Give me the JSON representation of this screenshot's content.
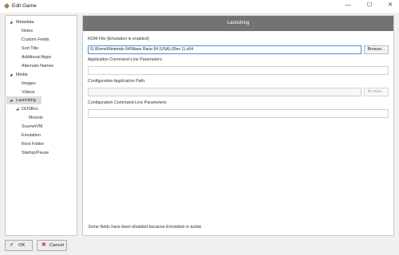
{
  "window": {
    "title": "Edit Game",
    "minimize_glyph": "—",
    "maximize_glyph": "☐",
    "close_glyph": "✕"
  },
  "sidebar": {
    "items": [
      {
        "label": "Metadata",
        "toggle": "◢"
      },
      {
        "label": "Notes"
      },
      {
        "label": "Custom Fields"
      },
      {
        "label": "Sort Title"
      },
      {
        "label": "Additional Apps"
      },
      {
        "label": "Alternate Names"
      },
      {
        "label": "Media",
        "toggle": "◢"
      },
      {
        "label": "Images"
      },
      {
        "label": "Videos"
      },
      {
        "label": "Launching",
        "toggle": "◢",
        "selected": true
      },
      {
        "label": "DOSBox",
        "toggle": "◢"
      },
      {
        "label": "Mounts"
      },
      {
        "label": "ScummVM"
      },
      {
        "label": "Emulation"
      },
      {
        "label": "Root Folder"
      },
      {
        "label": "Startup/Pause"
      }
    ]
  },
  "main": {
    "header": "Launching",
    "rom_file": {
      "label": "ROM File (Emulation is enabled):",
      "value": "G:\\Roms\\Nintendo 64\\Wave Race 64 (USA) (Rev 1).z64",
      "browse": "Browse..."
    },
    "app_cmd": {
      "label": "Application Command-Line Parameters:",
      "value": ""
    },
    "config_app": {
      "label": "Configuration Application Path:",
      "value": "",
      "browse": "Browse..."
    },
    "config_cmd": {
      "label": "Configuration Command-Line Parameters:",
      "value": ""
    },
    "footer_note": "Some fields have been disabled because Emulation is active."
  },
  "buttons": {
    "ok": {
      "label": "OK",
      "icon": "check-icon",
      "glyph": "✔"
    },
    "cancel": {
      "label": "Cancel",
      "icon": "close-icon",
      "glyph": "✖"
    }
  },
  "colors": {
    "header_bg": "#737373",
    "ok_icon": "#2e9e3e",
    "cancel_icon": "#d32f2f",
    "focus_border": "#4a8fd9"
  }
}
